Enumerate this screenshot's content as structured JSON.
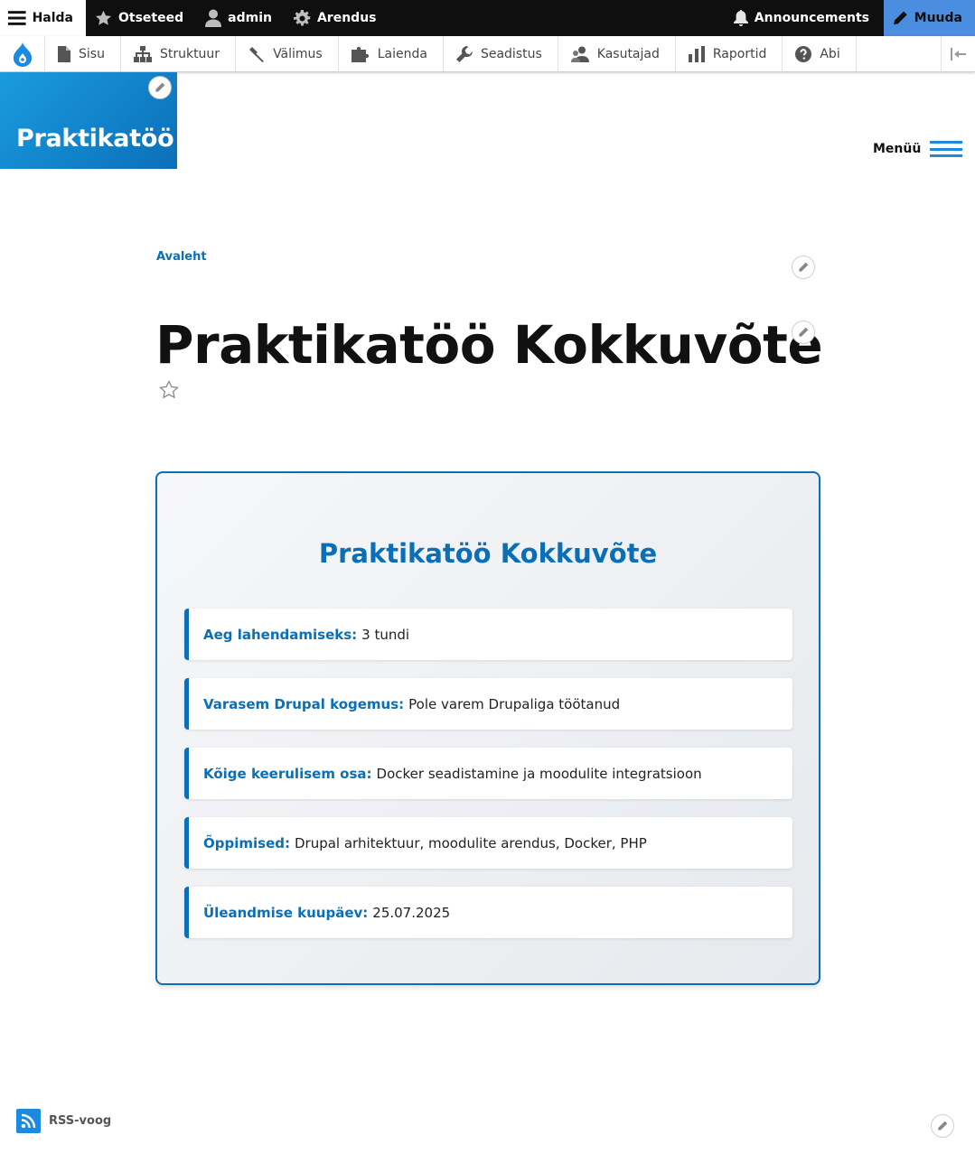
{
  "toolbar": {
    "manage": "Halda",
    "shortcuts": "Otseteed",
    "user": "admin",
    "development": "Arendus",
    "announcements": "Announcements",
    "edit": "Muuda"
  },
  "tray": {
    "items": [
      {
        "label": "Sisu",
        "icon": "file-icon"
      },
      {
        "label": "Struktuur",
        "icon": "sitemap-icon"
      },
      {
        "label": "Välimus",
        "icon": "paint-icon"
      },
      {
        "label": "Laienda",
        "icon": "puzzle-icon"
      },
      {
        "label": "Seadistus",
        "icon": "wrench-icon"
      },
      {
        "label": "Kasutajad",
        "icon": "people-icon"
      },
      {
        "label": "Raportid",
        "icon": "bar-chart-icon"
      },
      {
        "label": "Abi",
        "icon": "help-icon"
      }
    ]
  },
  "site": {
    "name": "Praktikatöö",
    "menu_label": "Menüü"
  },
  "breadcrumb": {
    "home": "Avaleht"
  },
  "page": {
    "title": "Praktikatöö Kokkuvõte"
  },
  "summary": {
    "title": "Praktikatöö Kokkuvõte",
    "rows": [
      {
        "label": "Aeg lahendamiseks:",
        "value": "3 tundi"
      },
      {
        "label": "Varasem Drupal kogemus:",
        "value": "Pole varem Drupaliga töötanud"
      },
      {
        "label": "Kõige keerulisem osa:",
        "value": "Docker seadistamine ja moodulite integratsioon"
      },
      {
        "label": "Õppimised:",
        "value": "Drupal arhitektuur, moodulite arendus, Docker, PHP"
      },
      {
        "label": "Üleandmise kuupäev:",
        "value": "25.07.2025"
      }
    ]
  },
  "footer": {
    "rss": "RSS-voog"
  },
  "colors": {
    "accent": "#0b6fb8",
    "toolbar_bg": "#0f0f0f",
    "edit_bg": "#4b8ee0",
    "brand_gradient_start": "#1a9be0",
    "brand_gradient_end": "#0b6fb8"
  }
}
